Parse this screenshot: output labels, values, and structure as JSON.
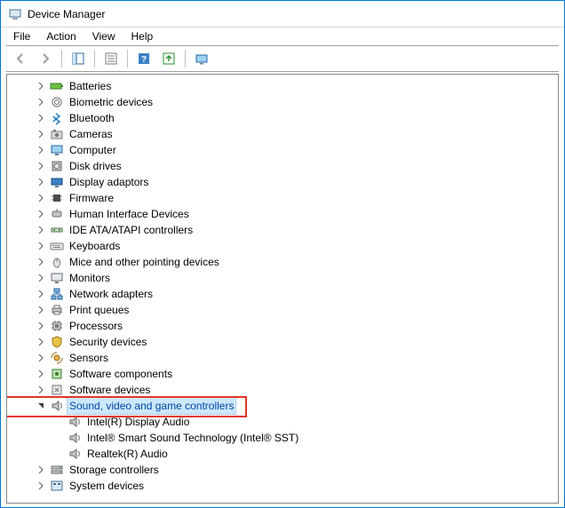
{
  "window": {
    "title": "Device Manager"
  },
  "menu": {
    "file": "File",
    "action": "Action",
    "view": "View",
    "help": "Help"
  },
  "categories": [
    {
      "id": "batteries",
      "label": "Batteries",
      "icon": "battery"
    },
    {
      "id": "biometric",
      "label": "Biometric devices",
      "icon": "fingerprint"
    },
    {
      "id": "bluetooth",
      "label": "Bluetooth",
      "icon": "bluetooth"
    },
    {
      "id": "cameras",
      "label": "Cameras",
      "icon": "camera"
    },
    {
      "id": "computer",
      "label": "Computer",
      "icon": "monitor"
    },
    {
      "id": "diskdrives",
      "label": "Disk drives",
      "icon": "disk"
    },
    {
      "id": "display",
      "label": "Display adaptors",
      "icon": "display"
    },
    {
      "id": "firmware",
      "label": "Firmware",
      "icon": "chip"
    },
    {
      "id": "hid",
      "label": "Human Interface Devices",
      "icon": "hid"
    },
    {
      "id": "ide",
      "label": "IDE ATA/ATAPI controllers",
      "icon": "ide"
    },
    {
      "id": "keyboards",
      "label": "Keyboards",
      "icon": "keyboard"
    },
    {
      "id": "mice",
      "label": "Mice and other pointing devices",
      "icon": "mouse"
    },
    {
      "id": "monitors",
      "label": "Monitors",
      "icon": "monitor2"
    },
    {
      "id": "network",
      "label": "Network adapters",
      "icon": "network"
    },
    {
      "id": "printqueues",
      "label": "Print queues",
      "icon": "printer"
    },
    {
      "id": "processors",
      "label": "Processors",
      "icon": "cpu"
    },
    {
      "id": "security",
      "label": "Security devices",
      "icon": "shield"
    },
    {
      "id": "sensors",
      "label": "Sensors",
      "icon": "sensor"
    },
    {
      "id": "swcomp",
      "label": "Software components",
      "icon": "swcomp"
    },
    {
      "id": "swdev",
      "label": "Software devices",
      "icon": "swdev"
    },
    {
      "id": "sound",
      "label": "Sound, video and game controllers",
      "icon": "speaker",
      "expanded": true,
      "selected": true,
      "children": [
        {
          "id": "idisplayaudio",
          "label": "Intel(R) Display Audio",
          "icon": "speaker"
        },
        {
          "id": "isst",
          "label": "Intel® Smart Sound Technology (Intel® SST)",
          "icon": "speaker"
        },
        {
          "id": "realtek",
          "label": "Realtek(R) Audio",
          "icon": "speaker"
        }
      ]
    },
    {
      "id": "storage",
      "label": "Storage controllers",
      "icon": "storage"
    },
    {
      "id": "sysdev",
      "label": "System devices",
      "icon": "system"
    }
  ]
}
